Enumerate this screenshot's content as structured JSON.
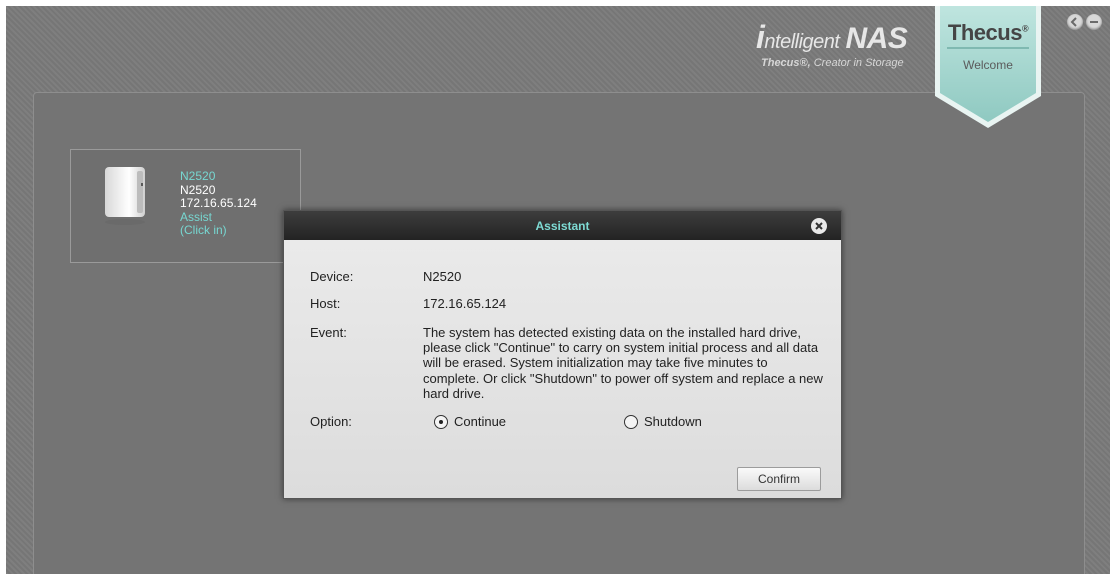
{
  "brand": {
    "title_i": "i",
    "title_rest": "ntelligent",
    "title_nas": "NAS",
    "tagline_bold": "Thecus®,",
    "tagline_rest": "Creator in Storage",
    "logo": "Thecus",
    "logo_mark": "®",
    "welcome": "Welcome"
  },
  "window_controls": {
    "prev_icon": "back-arrow-icon",
    "minimize_icon": "minimize-icon"
  },
  "device_card": {
    "name": "N2520",
    "model": "N2520",
    "ip": "172.16.65.124",
    "assist": "Assist",
    "click_in": "(Click in)",
    "image_icon": "nas-device-icon"
  },
  "dialog": {
    "title": "Assistant",
    "close_icon": "close-icon",
    "device_label": "Device:",
    "device_value": "N2520",
    "host_label": "Host:",
    "host_value": "172.16.65.124",
    "event_label": "Event:",
    "event_text": "The system has detected existing data on the installed hard drive, please click \"Continue\" to carry on system initial process and all data will be erased. System initialization may take five minutes to complete. Or click \"Shutdown\" to power off system and replace a new hard drive.",
    "option_label": "Option:",
    "options": [
      {
        "label": "Continue",
        "selected": true
      },
      {
        "label": "Shutdown",
        "selected": false
      }
    ],
    "confirm_label": "Confirm"
  },
  "colors": {
    "background": "#7a7a7a",
    "accent_teal": "#77d7d1",
    "shield": "#a9d9d2",
    "dialog_header": "#2b2b2b"
  }
}
